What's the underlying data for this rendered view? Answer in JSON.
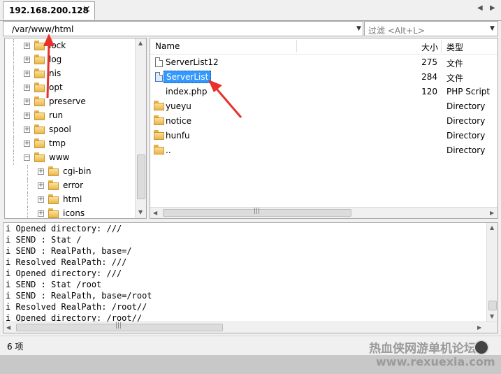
{
  "tab": {
    "title": "192.168.200.128",
    "close": "✕"
  },
  "nav": {
    "prev": "◀",
    "next": "▶"
  },
  "path": {
    "value": "/var/www/html"
  },
  "filter": {
    "placeholder": "过滤 <Alt+L>"
  },
  "tree": {
    "items": [
      {
        "label": "lock",
        "level": 0,
        "expander": "+"
      },
      {
        "label": "log",
        "level": 0,
        "expander": "+"
      },
      {
        "label": "nis",
        "level": 0,
        "expander": "+"
      },
      {
        "label": "opt",
        "level": 0,
        "expander": "+"
      },
      {
        "label": "preserve",
        "level": 0,
        "expander": "+"
      },
      {
        "label": "run",
        "level": 0,
        "expander": "+"
      },
      {
        "label": "spool",
        "level": 0,
        "expander": "+"
      },
      {
        "label": "tmp",
        "level": 0,
        "expander": "+"
      },
      {
        "label": "www",
        "level": 0,
        "expander": "−"
      },
      {
        "label": "cgi-bin",
        "level": 1,
        "expander": "+"
      },
      {
        "label": "error",
        "level": 1,
        "expander": "+"
      },
      {
        "label": "html",
        "level": 1,
        "expander": "+"
      },
      {
        "label": "icons",
        "level": 1,
        "expander": "+"
      }
    ]
  },
  "filelist": {
    "columns": {
      "name": "Name",
      "size": "大小",
      "type": "类型"
    },
    "rows": [
      {
        "name": "ServerList12",
        "size": "275",
        "type": "文件",
        "icon": "file-icon",
        "selected": false
      },
      {
        "name": "ServerList",
        "size": "284",
        "type": "文件",
        "icon": "file-icon",
        "selected": true
      },
      {
        "name": "index.php",
        "size": "120",
        "type": "PHP Script",
        "icon": "none",
        "selected": false
      },
      {
        "name": "yueyu",
        "size": "",
        "type": "Directory",
        "icon": "folder-icon",
        "selected": false
      },
      {
        "name": "notice",
        "size": "",
        "type": "Directory",
        "icon": "folder-icon",
        "selected": false
      },
      {
        "name": "hunfu",
        "size": "",
        "type": "Directory",
        "icon": "folder-icon",
        "selected": false
      },
      {
        "name": "..",
        "size": "",
        "type": "Directory",
        "icon": "folder-icon",
        "selected": false
      }
    ]
  },
  "log": {
    "lines": [
      "i Opened directory: ///",
      "i SEND : Stat /",
      "i SEND : RealPath, base=/",
      "i Resolved RealPath: ///",
      "i Opened directory: ///",
      "i SEND : Stat /root",
      "i SEND : RealPath, base=/root",
      "i Resolved RealPath: /root//",
      "i Opened directory: /root//"
    ]
  },
  "status": {
    "text": "6 项"
  },
  "watermark": {
    "line1": "热血侠网游单机论坛",
    "line2": "www.rexuexia.com"
  },
  "colors": {
    "selection": "#3399ff",
    "annotation": "#e8312a",
    "folder": "#e8b64c"
  }
}
